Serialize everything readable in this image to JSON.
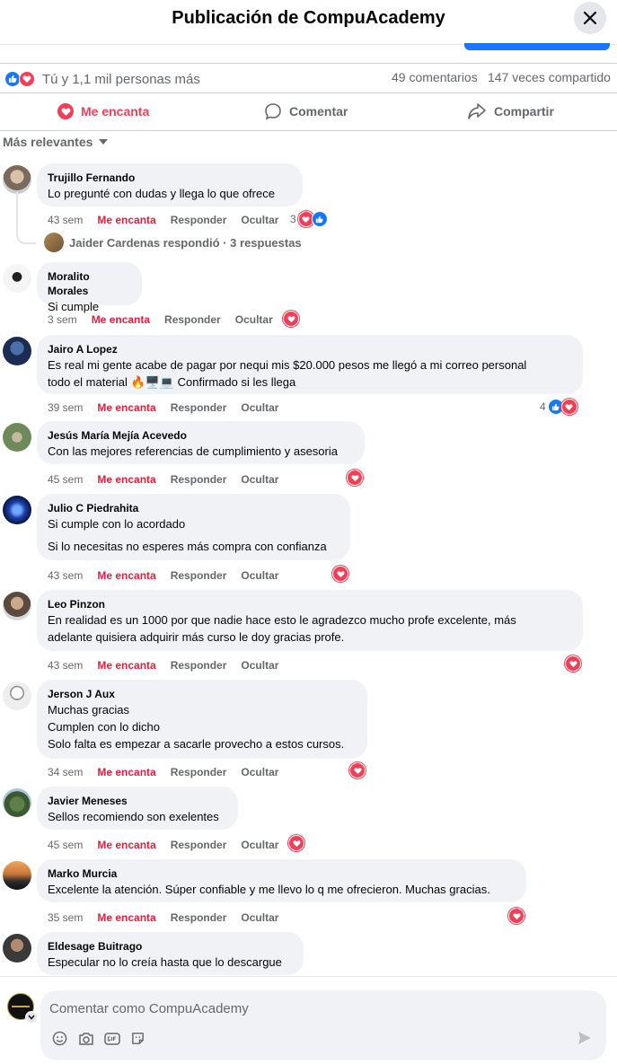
{
  "header": {
    "title": "Publicación de CompuAcademy"
  },
  "stats": {
    "reactors": "Tú y 1,1 mil personas más",
    "comments": "49 comentarios",
    "shares": "147 veces compartido"
  },
  "actions": {
    "love": "Me encanta",
    "comment": "Comentar",
    "share": "Compartir"
  },
  "sort": {
    "label": "Más relevantes"
  },
  "colors": {
    "brand_blue": "#1877f2",
    "love_red": "#f33e58",
    "love_label": "#e41e3f",
    "bubble_bg": "#f0f2f5",
    "muted": "#65676b"
  },
  "comment_actions": {
    "love": "Me encanta",
    "reply": "Responder",
    "hide": "Ocultar"
  },
  "comments": [
    {
      "author": "Trujillo Fernando",
      "lines": [
        "Lo pregunté con dudas y llega lo que ofrece"
      ],
      "time": "43 sem",
      "reaction_count": "3",
      "reactions": [
        "love",
        "like"
      ]
    },
    {
      "author": "Moralito Morales",
      "lines": [
        "Si cumple"
      ],
      "time": "3 sem",
      "reaction_count": "",
      "reactions": [
        "love"
      ]
    },
    {
      "author": "Jairo A Lopez",
      "lines": [
        "Es real mi gente acabe de pagar por nequi mis $20.000 pesos me llegó a mi correo personal",
        "todo el material 🔥🖥️💻 Confirmado si les llega"
      ],
      "time": "39 sem",
      "reaction_count": "4",
      "reactions": [
        "like",
        "love"
      ]
    },
    {
      "author": "Jesús María Mejía Acevedo",
      "lines": [
        "Con las mejores referencias de cumplimiento y asesoria"
      ],
      "time": "45 sem",
      "reaction_count": "",
      "reactions": [
        "love"
      ]
    },
    {
      "author": "Julio C Piedrahita",
      "lines": [
        "Si cumple con lo acordado",
        "",
        "Si lo necesitas no esperes más compra con confianza"
      ],
      "time": "43 sem",
      "reaction_count": "",
      "reactions": [
        "love"
      ]
    },
    {
      "author": "Leo Pinzon",
      "lines": [
        "En realidad es un 1000 por que nadie hace esto le agradezco mucho profe excelente, más",
        "adelante quisiera adquirir más curso le doy gracias profe."
      ],
      "time": "43 sem",
      "reaction_count": "",
      "reactions": [
        "love"
      ]
    },
    {
      "author": "Jerson J Aux",
      "lines": [
        "Muchas gracias",
        "Cumplen con lo dicho",
        "Solo falta es empezar a sacarle provecho a estos cursos."
      ],
      "time": "34 sem",
      "reaction_count": "",
      "reactions": [
        "love"
      ]
    },
    {
      "author": "Javier Meneses",
      "lines": [
        "Sellos recomiendo son exelentes"
      ],
      "time": "45 sem",
      "reaction_count": "",
      "reactions": [
        "love"
      ]
    },
    {
      "author": "Marko Murcia",
      "lines": [
        "Excelente la atención. Súper confiable y me llevo lo q me ofrecieron. Muchas gracias."
      ],
      "time": "35 sem",
      "reaction_count": "",
      "reactions": [
        "love"
      ]
    },
    {
      "author": "Eldesage Buitrago",
      "lines": [
        "Especular no lo creía hasta que lo descargue"
      ],
      "time": "",
      "reaction_count": "",
      "reactions": []
    }
  ],
  "thread": {
    "replied_text": "Jaider Cardenas respondió · 3 respuestas"
  },
  "composer": {
    "placeholder": "Comentar como CompuAcademy",
    "value": ""
  },
  "icons": {
    "tools": [
      "emoji-icon",
      "camera-icon",
      "gif-icon",
      "sticker-icon"
    ],
    "send": "send-icon"
  }
}
